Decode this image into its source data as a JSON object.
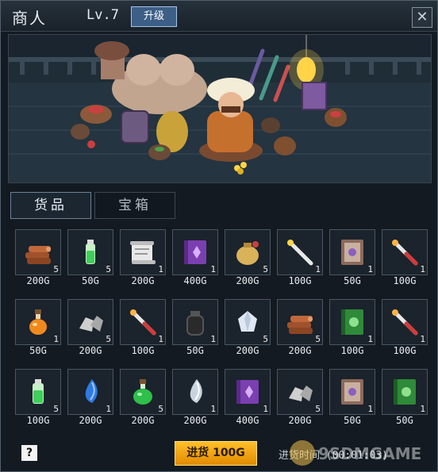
{
  "header": {
    "title": "商人",
    "level": "Lv.7",
    "upgrade_label": "升级"
  },
  "tabs": [
    {
      "label": "货品"
    },
    {
      "label": "宝箱"
    }
  ],
  "items": [
    {
      "icon": "wood-logs-icon",
      "qty": "5",
      "price": "200G"
    },
    {
      "icon": "green-vial-icon",
      "qty": "5",
      "price": "50G"
    },
    {
      "icon": "scroll-icon",
      "qty": "1",
      "price": "200G"
    },
    {
      "icon": "purple-spellbook-icon",
      "qty": "1",
      "price": "400G"
    },
    {
      "icon": "gold-pouch-icon",
      "qty": "5",
      "price": "200G"
    },
    {
      "icon": "magic-wand-icon",
      "qty": "1",
      "price": "100G"
    },
    {
      "icon": "brown-spellbook-icon",
      "qty": "1",
      "price": "50G"
    },
    {
      "icon": "red-wand-icon",
      "qty": "1",
      "price": "100G"
    },
    {
      "icon": "orange-potion-icon",
      "qty": "1",
      "price": "50G"
    },
    {
      "icon": "iron-ore-icon",
      "qty": "5",
      "price": "200G"
    },
    {
      "icon": "red-wand-icon",
      "qty": "1",
      "price": "100G"
    },
    {
      "icon": "black-jar-icon",
      "qty": "1",
      "price": "50G"
    },
    {
      "icon": "crystal-icon",
      "qty": "5",
      "price": "200G"
    },
    {
      "icon": "wood-logs-icon",
      "qty": "5",
      "price": "200G"
    },
    {
      "icon": "green-spellbook-icon",
      "qty": "1",
      "price": "100G"
    },
    {
      "icon": "red-wand-icon",
      "qty": "1",
      "price": "100G"
    },
    {
      "icon": "green-vial-icon",
      "qty": "5",
      "price": "100G"
    },
    {
      "icon": "blue-gem-icon",
      "qty": "1",
      "price": "200G"
    },
    {
      "icon": "green-potion-icon",
      "qty": "5",
      "price": "200G"
    },
    {
      "icon": "silver-gem-icon",
      "qty": "1",
      "price": "200G"
    },
    {
      "icon": "purple-spellbook-icon",
      "qty": "1",
      "price": "400G"
    },
    {
      "icon": "iron-ore-icon",
      "qty": "5",
      "price": "200G"
    },
    {
      "icon": "brown-spellbook-icon",
      "qty": "1",
      "price": "50G"
    },
    {
      "icon": "green-spellbook-icon",
      "qty": "1",
      "price": "50G"
    }
  ],
  "footer": {
    "help_label": "?",
    "restock_label": "进货 100G",
    "timer_text": "进货时间 (00:01:03)"
  },
  "watermark": "9SDMGAME"
}
